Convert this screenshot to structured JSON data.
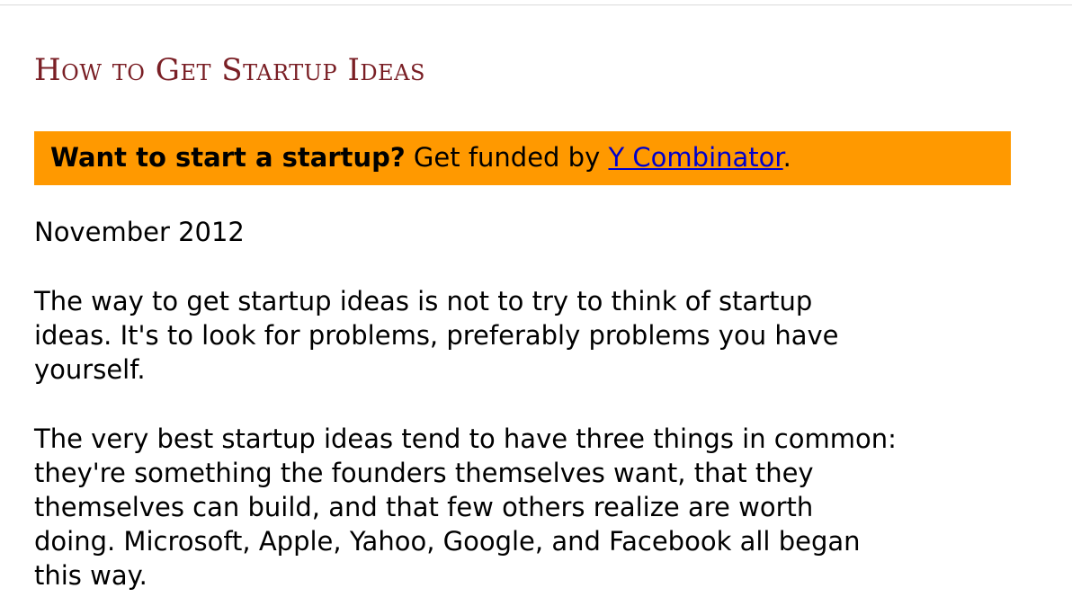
{
  "article": {
    "title": "How to Get Startup Ideas",
    "banner": {
      "bold_text": "Want to start a startup?",
      "text": " Get funded by ",
      "link_text": "Y Combinator",
      "trailing": "."
    },
    "date": "November 2012",
    "paragraphs": [
      "The way to get startup ideas is not to try to think of startup\nideas. It's to look for problems, preferably problems you have\nyourself.",
      "The very best startup ideas tend to have three things in common:\nthey're something the founders themselves want, that they\nthemselves can build, and that few others realize are worth\ndoing. Microsoft, Apple, Yahoo, Google, and Facebook all began\nthis way."
    ]
  },
  "colors": {
    "title": "#7a1f25",
    "banner_background": "#ff9900",
    "link": "#0000cc"
  }
}
